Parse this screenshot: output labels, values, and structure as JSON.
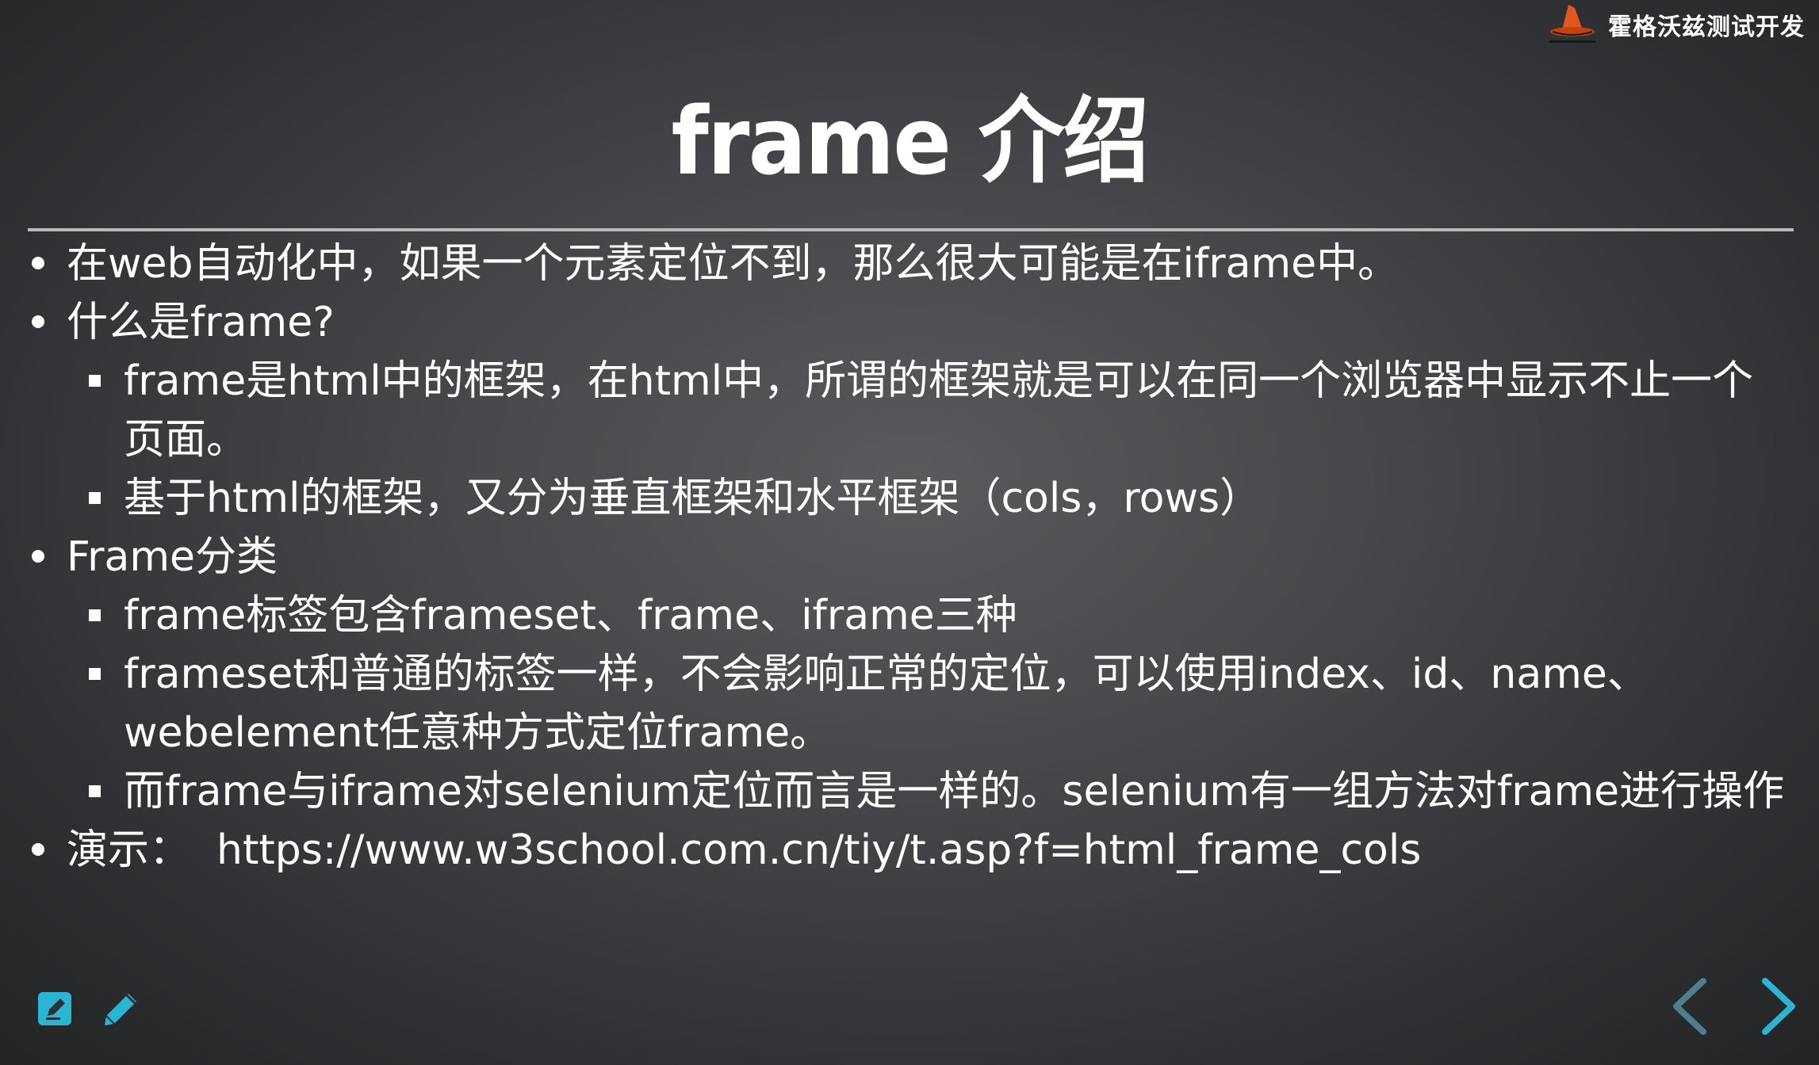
{
  "brand": {
    "name": "霍格沃兹测试开发",
    "logo_icon": "wizard-hat-icon"
  },
  "slide": {
    "title": "frame 介绍",
    "items": [
      {
        "level": 1,
        "text": "在web自动化中，如果一个元素定位不到，那么很大可能是在iframe中。"
      },
      {
        "level": 1,
        "text": "什么是frame?"
      },
      {
        "level": 2,
        "text": "frame是html中的框架，在html中，所谓的框架就是可以在同一个浏览器中显示不止一个页面。"
      },
      {
        "level": 2,
        "text": "基于html的框架，又分为垂直框架和水平框架（cols，rows）"
      },
      {
        "level": 1,
        "text": "Frame分类"
      },
      {
        "level": 2,
        "text": "frame标签包含frameset、frame、iframe三种"
      },
      {
        "level": 2,
        "text": "frameset和普通的标签一样，不会影响正常的定位，可以使用index、id、name、webelement任意种方式定位frame。"
      },
      {
        "level": 2,
        "text": "而frame与iframe对selenium定位而言是一样的。selenium有一组方法对frame进行操作"
      },
      {
        "level": 1,
        "text": "演示：  https://www.w3school.com.cn/tiy/t.asp?f=html_frame_cols"
      }
    ]
  },
  "toolbar": {
    "edit_icon": "edit-note-icon",
    "pen_icon": "pencil-icon"
  },
  "navigation": {
    "prev_icon": "chevron-left-icon",
    "next_icon": "chevron-right-icon"
  },
  "colors": {
    "accent": "#2bb5d4",
    "accent_dim": "#4f7f8e",
    "logo": "#e2571e"
  }
}
